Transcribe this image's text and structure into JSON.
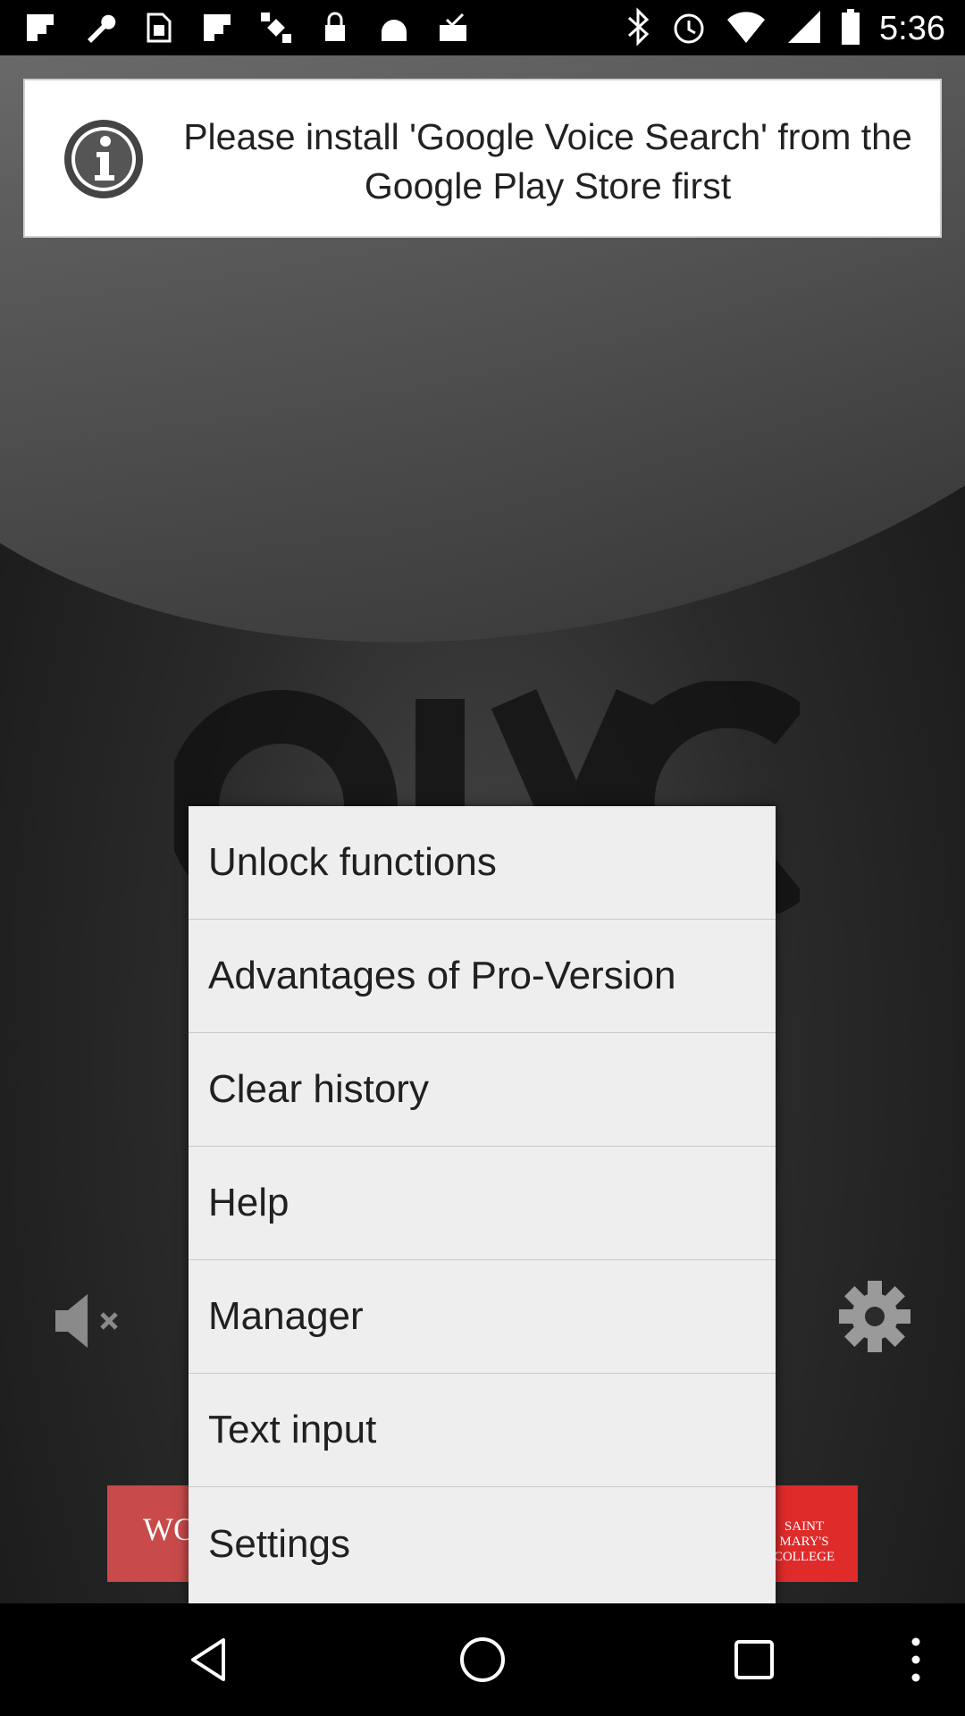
{
  "status_bar": {
    "time": "5:36",
    "left_icons": [
      "flipboard-icon",
      "wrench-icon",
      "sim-icon",
      "flipboard-icon",
      "fake-gps-icon",
      "lock-icon",
      "android-icon",
      "inbox-check-icon"
    ],
    "right_icons": [
      "bluetooth-icon",
      "alarm-icon",
      "wifi-icon",
      "signal-icon",
      "battery-icon"
    ]
  },
  "toast": {
    "message": "Please install 'Google Voice Search' from the Google Play Store first"
  },
  "menu": {
    "items": [
      {
        "label": "Unlock functions"
      },
      {
        "label": "Advantages of Pro-Version"
      },
      {
        "label": "Clear history"
      },
      {
        "label": "Help"
      },
      {
        "label": "Manager"
      },
      {
        "label": "Text input"
      },
      {
        "label": "Settings"
      }
    ]
  },
  "ad": {
    "left_text": "WO",
    "right_lines": [
      "SAINT",
      "MARY'S",
      "COLLEGE"
    ]
  },
  "colors": {
    "menu_bg": "#eeeeee",
    "toast_bg": "#ffffff",
    "statusbar_bg": "#000000"
  }
}
